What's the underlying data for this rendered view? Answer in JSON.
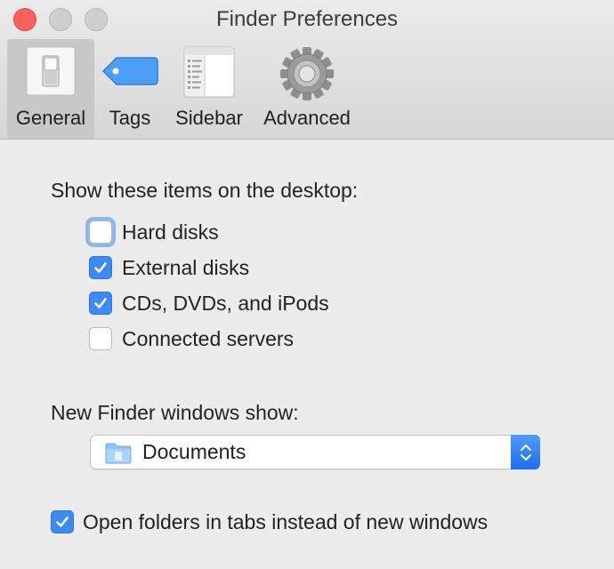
{
  "window": {
    "title": "Finder Preferences"
  },
  "toolbar": {
    "items": [
      {
        "label": "General",
        "icon": "switch-icon",
        "selected": true
      },
      {
        "label": "Tags",
        "icon": "tag-icon",
        "selected": false
      },
      {
        "label": "Sidebar",
        "icon": "sidebar-icon",
        "selected": false
      },
      {
        "label": "Advanced",
        "icon": "gear-icon",
        "selected": false
      }
    ]
  },
  "desktop": {
    "heading": "Show these items on the desktop:",
    "items": [
      {
        "label": "Hard disks",
        "checked": false
      },
      {
        "label": "External disks",
        "checked": true
      },
      {
        "label": "CDs, DVDs, and iPods",
        "checked": true
      },
      {
        "label": "Connected servers",
        "checked": false
      }
    ]
  },
  "new_window": {
    "heading": "New Finder windows show:",
    "selected": "Documents",
    "icon": "folder-icon"
  },
  "tabs_option": {
    "label": "Open folders in tabs instead of new windows",
    "checked": true
  },
  "colors": {
    "accent": "#3d8af7",
    "close": "#fc605b",
    "tag": "#4b9ff5"
  }
}
